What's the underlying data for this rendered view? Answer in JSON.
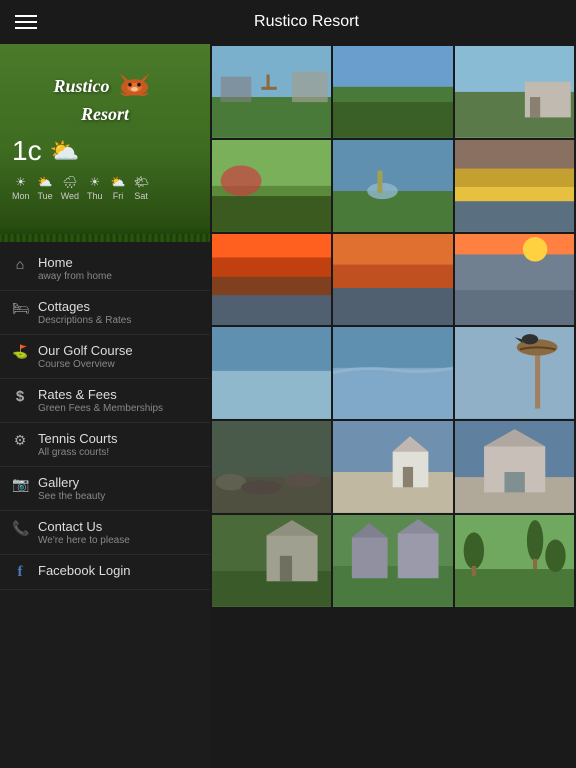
{
  "topBar": {
    "title": "Rustico Resort"
  },
  "sidebar": {
    "temperature": "1",
    "tempUnit": "c",
    "weatherDays": [
      {
        "day": "Mon",
        "icon": "☀"
      },
      {
        "day": "Tue",
        "icon": "⛅"
      },
      {
        "day": "Wed",
        "icon": "🌧"
      },
      {
        "day": "Thu",
        "icon": "☀"
      },
      {
        "day": "Fri",
        "icon": "⛅"
      },
      {
        "day": "Sat",
        "icon": "🌤"
      }
    ],
    "navItems": [
      {
        "id": "home",
        "icon": "🏠",
        "title": "Home",
        "subtitle": "away from home"
      },
      {
        "id": "cottages",
        "icon": "🛏",
        "title": "Cottages",
        "subtitle": "Descriptions & Rates"
      },
      {
        "id": "golf",
        "icon": "⛳",
        "title": "Our Golf Course",
        "subtitle": "Course Overview"
      },
      {
        "id": "rates",
        "icon": "$",
        "title": "Rates & Fees",
        "subtitle": "Green Fees & Memberships"
      },
      {
        "id": "tennis",
        "icon": "⚙",
        "title": "Tennis Courts",
        "subtitle": "All grass courts!"
      },
      {
        "id": "gallery",
        "icon": "📷",
        "title": "Gallery",
        "subtitle": "See the beauty"
      },
      {
        "id": "contact",
        "icon": "📞",
        "title": "Contact Us",
        "subtitle": "We're here to please"
      },
      {
        "id": "facebook",
        "icon": "f",
        "title": "Facebook Login",
        "subtitle": ""
      }
    ]
  },
  "gallery": {
    "photos": [
      {
        "id": 1,
        "class": "photo-1",
        "alt": "Resort grounds"
      },
      {
        "id": 2,
        "class": "photo-2",
        "alt": "Green fields"
      },
      {
        "id": 3,
        "class": "photo-3",
        "alt": "Cottages"
      },
      {
        "id": 4,
        "class": "photo-4",
        "alt": "Garden"
      },
      {
        "id": 5,
        "class": "photo-5",
        "alt": "Water feature"
      },
      {
        "id": 6,
        "class": "photo-6",
        "alt": "Sunset water"
      },
      {
        "id": 7,
        "class": "photo-7",
        "alt": "Sunset sky"
      },
      {
        "id": 8,
        "class": "photo-8",
        "alt": "Sunset lake"
      },
      {
        "id": 9,
        "class": "photo-9",
        "alt": "Evening sky"
      },
      {
        "id": 10,
        "class": "photo-10",
        "alt": "Calm water"
      },
      {
        "id": 11,
        "class": "photo-11",
        "alt": "Water view"
      },
      {
        "id": 12,
        "class": "photo-12",
        "alt": "Bird nest"
      },
      {
        "id": 13,
        "class": "photo-13",
        "alt": "Shore rocks"
      },
      {
        "id": 14,
        "class": "photo-14",
        "alt": "Cottage buildings"
      },
      {
        "id": 15,
        "class": "photo-15",
        "alt": "Resort building"
      },
      {
        "id": 16,
        "class": "photo-16",
        "alt": "Buildings"
      },
      {
        "id": 17,
        "class": "photo-17",
        "alt": "Buildings 2"
      },
      {
        "id": 18,
        "class": "photo-18",
        "alt": "Golf course"
      }
    ]
  }
}
